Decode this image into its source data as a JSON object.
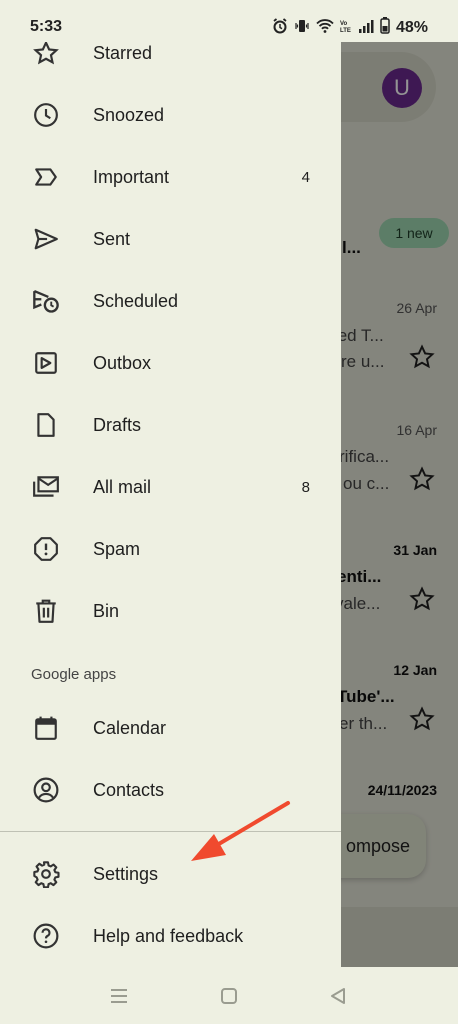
{
  "status_bar": {
    "time": "5:33",
    "battery_percent": "48%",
    "icons": [
      "alarm-icon",
      "vibrate-icon",
      "wifi-icon",
      "volte-icon",
      "signal-icon",
      "battery-icon"
    ]
  },
  "drawer": {
    "items": [
      {
        "label": "Starred",
        "icon": "star-icon",
        "count": ""
      },
      {
        "label": "Snoozed",
        "icon": "clock-icon",
        "count": ""
      },
      {
        "label": "Important",
        "icon": "important-icon",
        "count": "4"
      },
      {
        "label": "Sent",
        "icon": "send-icon",
        "count": ""
      },
      {
        "label": "Scheduled",
        "icon": "scheduled-send-icon",
        "count": ""
      },
      {
        "label": "Outbox",
        "icon": "outbox-icon",
        "count": ""
      },
      {
        "label": "Drafts",
        "icon": "draft-icon",
        "count": ""
      },
      {
        "label": "All mail",
        "icon": "all-mail-icon",
        "count": "8"
      },
      {
        "label": "Spam",
        "icon": "spam-icon",
        "count": ""
      },
      {
        "label": "Bin",
        "icon": "bin-icon",
        "count": ""
      }
    ],
    "google_apps_label": "Google apps",
    "apps": [
      {
        "label": "Calendar",
        "icon": "calendar-icon"
      },
      {
        "label": "Contacts",
        "icon": "contacts-icon"
      }
    ],
    "footer": [
      {
        "label": "Settings",
        "icon": "gear-icon"
      },
      {
        "label": "Help and feedback",
        "icon": "help-icon"
      }
    ]
  },
  "inbox_background": {
    "avatar_letter": "U",
    "new_badge": "1 new",
    "fragments": [
      "l...",
      "ted T...",
      "re u...",
      "rifica...",
      "ou c...",
      "enti...",
      " vale...",
      "Tube'...",
      "er th..."
    ],
    "dates": [
      "26 Apr",
      "16 Apr",
      "31 Jan",
      "12 Jan",
      "24/11/2023"
    ],
    "compose_label": "ompose"
  },
  "colors": {
    "drawer_bg": "#eef0e2",
    "annotation_arrow": "#f04a2e",
    "avatar": "#6b2a8f",
    "new_badge": "#9fd8b2"
  }
}
